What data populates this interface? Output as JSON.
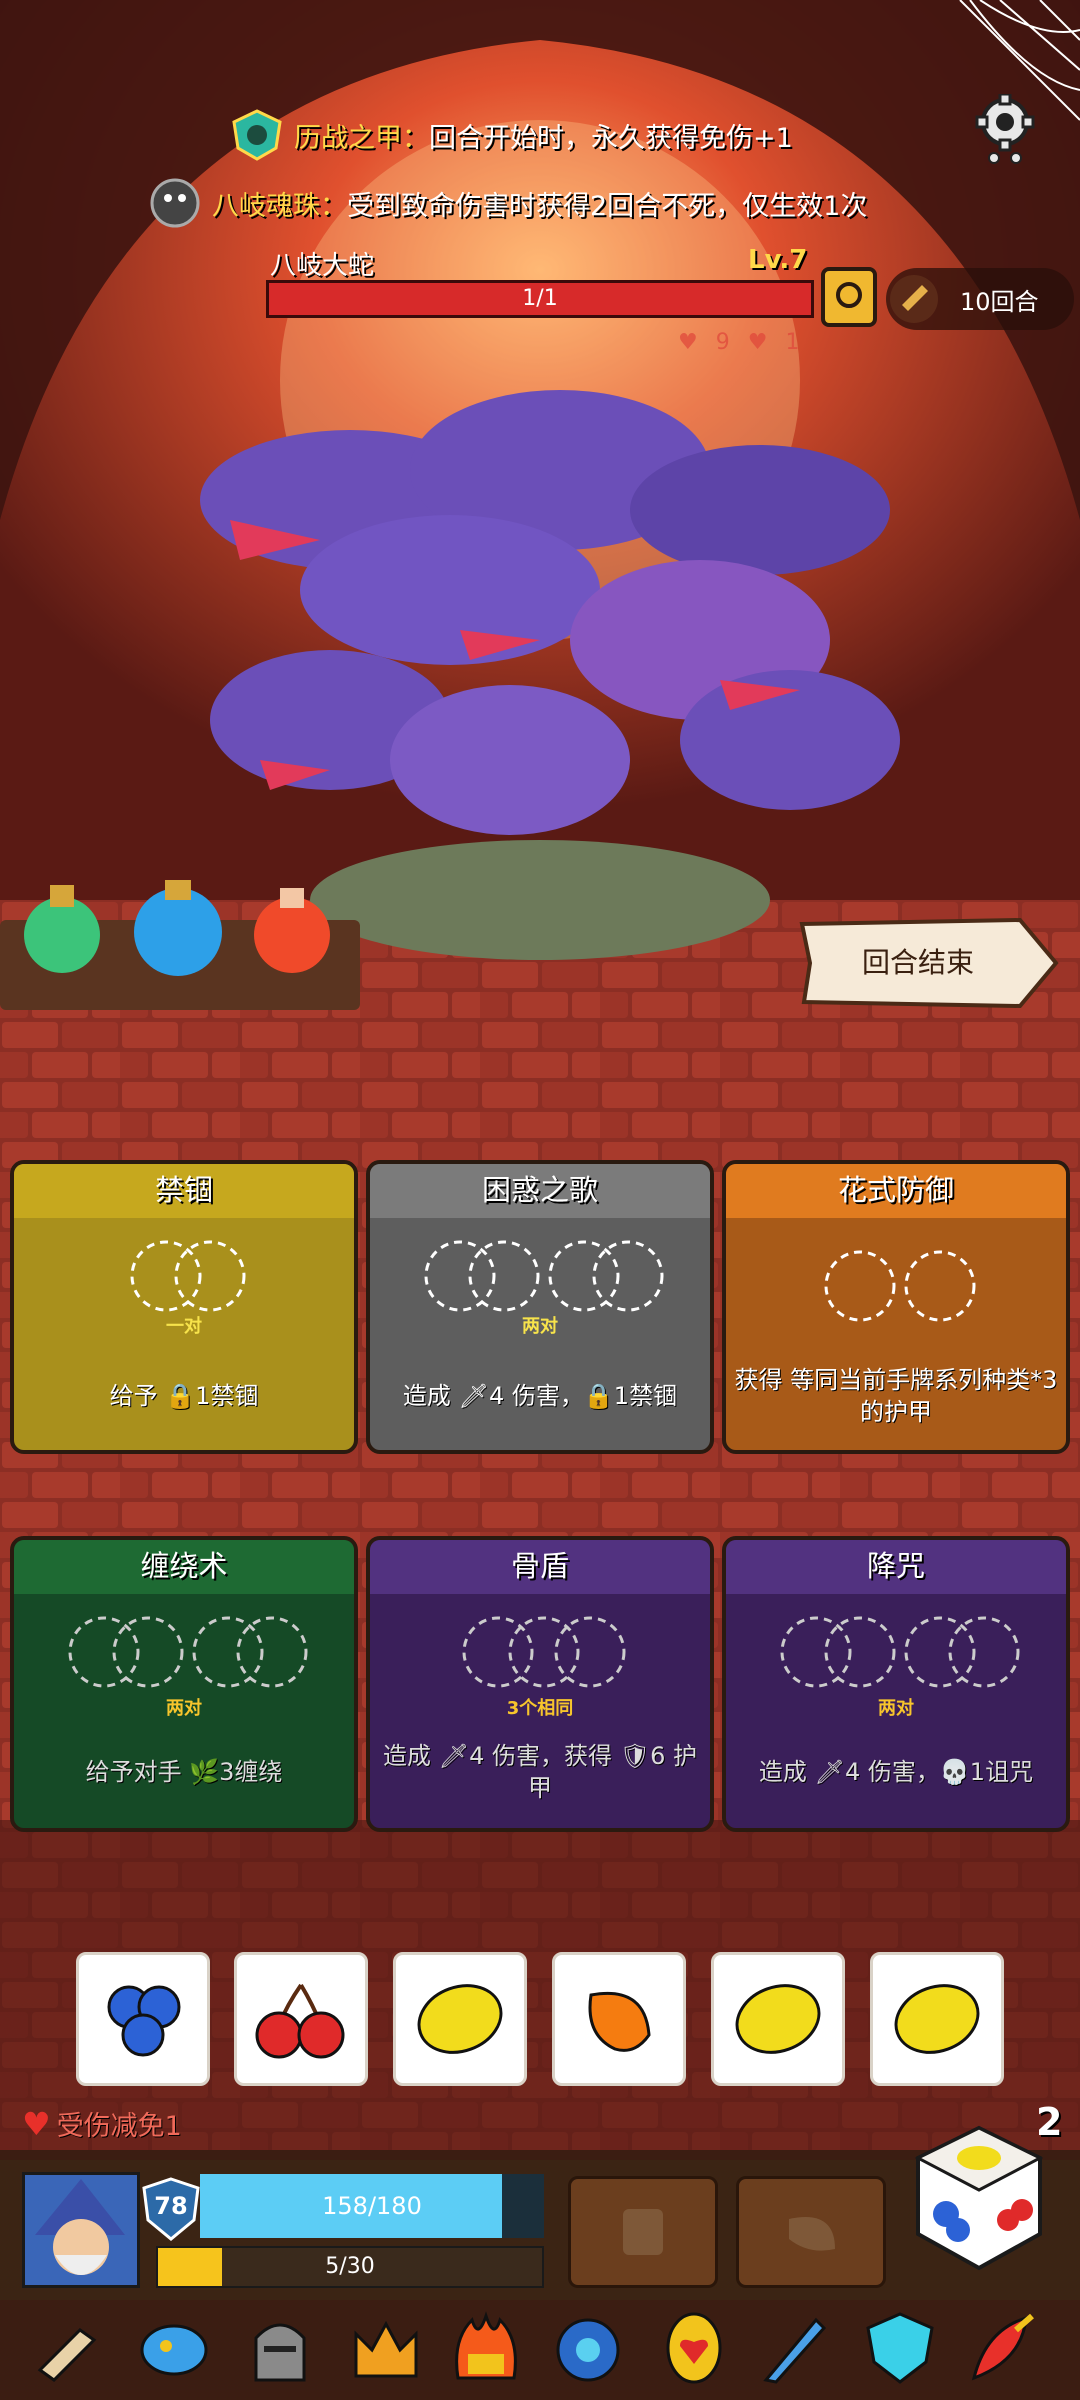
{
  "buffs": [
    {
      "name": "历战之甲：",
      "desc": "回合开始时，永久获得免伤+1",
      "icon": "armor-badge-icon"
    },
    {
      "name": "八岐魂珠：",
      "desc": "受到致命伤害时获得2回合不死，仅生效1次",
      "icon": "serpent-orb-icon"
    }
  ],
  "boss": {
    "name": "八岐大蛇",
    "level": "Lv.7",
    "hp_text": "1/1",
    "hp_fraction": 1.0,
    "stat_heart": "9",
    "stat_other": "1"
  },
  "turns": "10回合",
  "end_turn_label": "回合结束",
  "cards": [
    {
      "title": "禁锢",
      "req": "一对",
      "desc": "给予 🔒1禁锢",
      "color": "#a9901c",
      "header": "#c6a81e",
      "req_color": "#f7e34b"
    },
    {
      "title": "困惑之歌",
      "req": "两对",
      "desc": "造成 🗡4 伤害，🔒1禁锢",
      "color": "#5e5e5e",
      "header": "#7b7b7b",
      "req_color": "#f7e34b"
    },
    {
      "title": "花式防御",
      "req": "",
      "desc": "获得 等同当前手牌系列种类*3的护甲",
      "color": "#a85a18",
      "header": "#e07b1f",
      "req_color": "#f7e34b"
    },
    {
      "title": "缠绕术",
      "req": "两对",
      "desc": "给予对手 🌿3缠绕",
      "color": "#154a26",
      "header": "#1e6a33",
      "req_color": "#f7c52c"
    },
    {
      "title": "骨盾",
      "req": "3个相同",
      "desc": "造成 🗡4 伤害，获得 🛡6 护甲",
      "color": "#3a1f5a",
      "header": "#523280",
      "req_color": "#f7c52c"
    },
    {
      "title": "降咒",
      "req": "两对",
      "desc": "造成 🗡4 伤害，💀1诅咒",
      "color": "#3a1f5a",
      "header": "#523280",
      "req_color": "#f7c52c"
    }
  ],
  "hand": [
    "blueberry-icon",
    "cherry-icon",
    "lemon-icon",
    "orange-icon",
    "lemon-icon",
    "lemon-icon"
  ],
  "player": {
    "damage_reduction": "受伤减免1",
    "armor": "78",
    "hp_text": "158/180",
    "hp_fraction": 0.878,
    "energy_text": "5/30",
    "energy_fraction": 0.167,
    "dice_count": "2"
  },
  "relics": [
    "horn-icon",
    "blue-cookie-icon",
    "knight-helmet-icon",
    "golden-crown-icon",
    "flaming-crown-icon",
    "blue-dragon-icon",
    "heart-gem-icon",
    "ice-sword-icon",
    "crystal-shield-icon",
    "fire-dagger-icon"
  ]
}
